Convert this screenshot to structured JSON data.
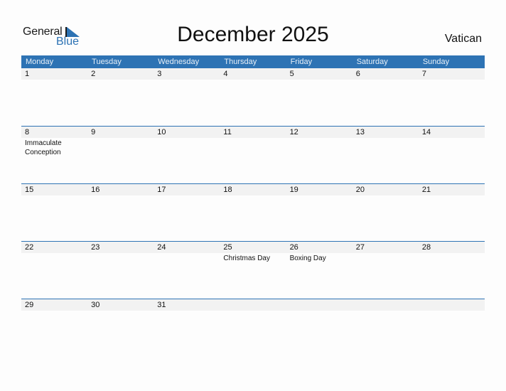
{
  "logo": {
    "line1": "General",
    "line2": "Blue"
  },
  "header": {
    "title": "December 2025",
    "country": "Vatican"
  },
  "colors": {
    "accent": "#2e73b4",
    "day_row_bg": "#f2f2f2"
  },
  "weekdays": [
    "Monday",
    "Tuesday",
    "Wednesday",
    "Thursday",
    "Friday",
    "Saturday",
    "Sunday"
  ],
  "weeks": [
    {
      "days": [
        "1",
        "2",
        "3",
        "4",
        "5",
        "6",
        "7"
      ],
      "events": [
        "",
        "",
        "",
        "",
        "",
        "",
        ""
      ]
    },
    {
      "days": [
        "8",
        "9",
        "10",
        "11",
        "12",
        "13",
        "14"
      ],
      "events": [
        "Immaculate Conception",
        "",
        "",
        "",
        "",
        "",
        ""
      ]
    },
    {
      "days": [
        "15",
        "16",
        "17",
        "18",
        "19",
        "20",
        "21"
      ],
      "events": [
        "",
        "",
        "",
        "",
        "",
        "",
        ""
      ]
    },
    {
      "days": [
        "22",
        "23",
        "24",
        "25",
        "26",
        "27",
        "28"
      ],
      "events": [
        "",
        "",
        "",
        "Christmas Day",
        "Boxing Day",
        "",
        ""
      ]
    },
    {
      "days": [
        "29",
        "30",
        "31",
        "",
        "",
        "",
        ""
      ],
      "events": [
        "",
        "",
        "",
        "",
        "",
        "",
        ""
      ]
    }
  ]
}
